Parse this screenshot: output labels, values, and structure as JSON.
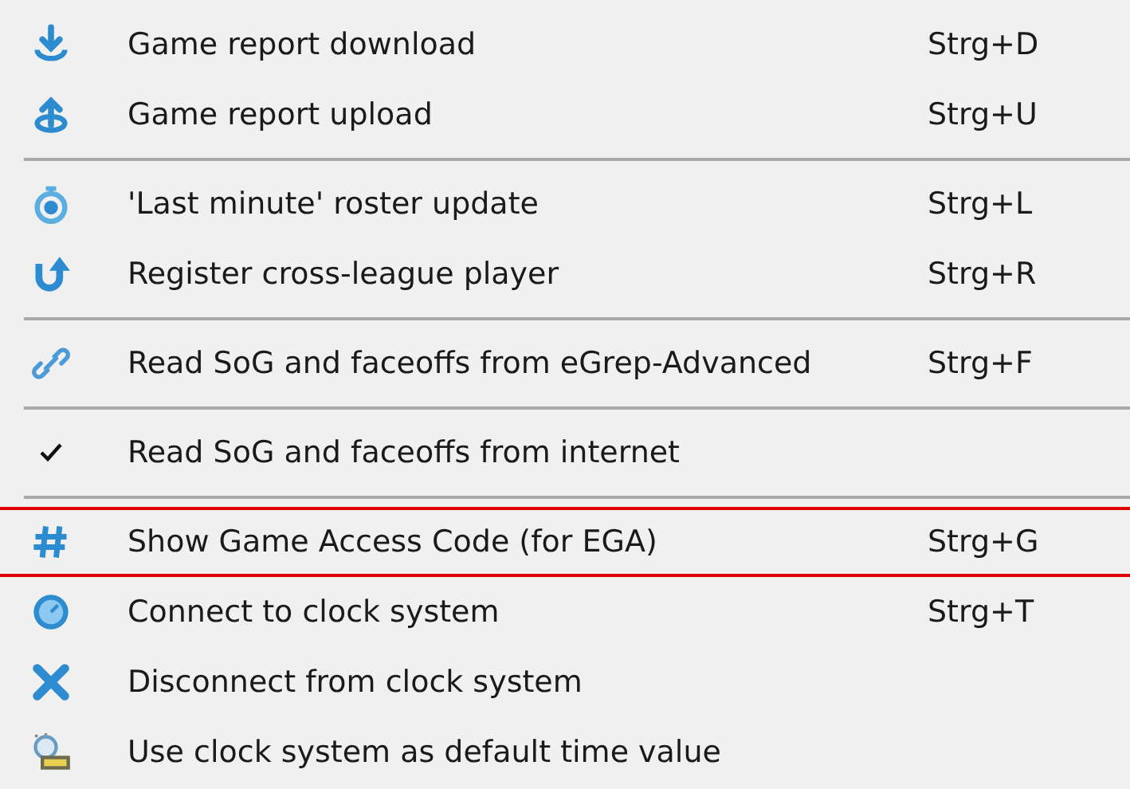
{
  "menu": {
    "sections": [
      {
        "items": [
          {
            "label": "Game report download",
            "shortcut": "Strg+D",
            "checked": false,
            "highlighted": false
          },
          {
            "label": "Game report upload",
            "shortcut": "Strg+U",
            "checked": false,
            "highlighted": false
          }
        ]
      },
      {
        "items": [
          {
            "label": "'Last minute' roster update",
            "shortcut": "Strg+L",
            "checked": false,
            "highlighted": false
          },
          {
            "label": "Register cross-league player",
            "shortcut": "Strg+R",
            "checked": false,
            "highlighted": false
          }
        ]
      },
      {
        "items": [
          {
            "label": "Read SoG and faceoffs from eGrep-Advanced",
            "shortcut": "Strg+F",
            "checked": false,
            "highlighted": false
          }
        ]
      },
      {
        "items": [
          {
            "label": "Read SoG and faceoffs from internet",
            "checked": true,
            "highlighted": false
          }
        ]
      },
      {
        "items": [
          {
            "label": "Show Game Access Code (for EGA)",
            "shortcut": "Strg+G",
            "checked": false,
            "highlighted": true
          },
          {
            "label": "Connect to clock system",
            "shortcut": "Strg+T",
            "checked": false,
            "highlighted": false
          },
          {
            "label": "Disconnect from clock system",
            "checked": false,
            "highlighted": false
          },
          {
            "label": "Use clock system as default time value",
            "checked": false,
            "highlighted": false
          }
        ]
      }
    ]
  }
}
